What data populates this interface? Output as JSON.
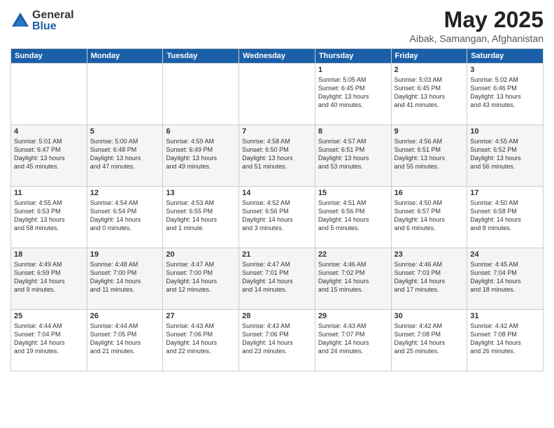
{
  "logo": {
    "general": "General",
    "blue": "Blue"
  },
  "title": "May 2025",
  "location": "Aibak, Samangan, Afghanistan",
  "weekdays": [
    "Sunday",
    "Monday",
    "Tuesday",
    "Wednesday",
    "Thursday",
    "Friday",
    "Saturday"
  ],
  "weeks": [
    [
      {
        "day": "",
        "info": ""
      },
      {
        "day": "",
        "info": ""
      },
      {
        "day": "",
        "info": ""
      },
      {
        "day": "",
        "info": ""
      },
      {
        "day": "1",
        "info": "Sunrise: 5:05 AM\nSunset: 6:45 PM\nDaylight: 13 hours\nand 40 minutes."
      },
      {
        "day": "2",
        "info": "Sunrise: 5:03 AM\nSunset: 6:45 PM\nDaylight: 13 hours\nand 41 minutes."
      },
      {
        "day": "3",
        "info": "Sunrise: 5:02 AM\nSunset: 6:46 PM\nDaylight: 13 hours\nand 43 minutes."
      }
    ],
    [
      {
        "day": "4",
        "info": "Sunrise: 5:01 AM\nSunset: 6:47 PM\nDaylight: 13 hours\nand 45 minutes."
      },
      {
        "day": "5",
        "info": "Sunrise: 5:00 AM\nSunset: 6:48 PM\nDaylight: 13 hours\nand 47 minutes."
      },
      {
        "day": "6",
        "info": "Sunrise: 4:59 AM\nSunset: 6:49 PM\nDaylight: 13 hours\nand 49 minutes."
      },
      {
        "day": "7",
        "info": "Sunrise: 4:58 AM\nSunset: 6:50 PM\nDaylight: 13 hours\nand 51 minutes."
      },
      {
        "day": "8",
        "info": "Sunrise: 4:57 AM\nSunset: 6:51 PM\nDaylight: 13 hours\nand 53 minutes."
      },
      {
        "day": "9",
        "info": "Sunrise: 4:56 AM\nSunset: 6:51 PM\nDaylight: 13 hours\nand 55 minutes."
      },
      {
        "day": "10",
        "info": "Sunrise: 4:55 AM\nSunset: 6:52 PM\nDaylight: 13 hours\nand 56 minutes."
      }
    ],
    [
      {
        "day": "11",
        "info": "Sunrise: 4:55 AM\nSunset: 6:53 PM\nDaylight: 13 hours\nand 58 minutes."
      },
      {
        "day": "12",
        "info": "Sunrise: 4:54 AM\nSunset: 6:54 PM\nDaylight: 14 hours\nand 0 minutes."
      },
      {
        "day": "13",
        "info": "Sunrise: 4:53 AM\nSunset: 6:55 PM\nDaylight: 14 hours\nand 1 minute."
      },
      {
        "day": "14",
        "info": "Sunrise: 4:52 AM\nSunset: 6:56 PM\nDaylight: 14 hours\nand 3 minutes."
      },
      {
        "day": "15",
        "info": "Sunrise: 4:51 AM\nSunset: 6:56 PM\nDaylight: 14 hours\nand 5 minutes."
      },
      {
        "day": "16",
        "info": "Sunrise: 4:50 AM\nSunset: 6:57 PM\nDaylight: 14 hours\nand 6 minutes."
      },
      {
        "day": "17",
        "info": "Sunrise: 4:50 AM\nSunset: 6:58 PM\nDaylight: 14 hours\nand 8 minutes."
      }
    ],
    [
      {
        "day": "18",
        "info": "Sunrise: 4:49 AM\nSunset: 6:59 PM\nDaylight: 14 hours\nand 9 minutes."
      },
      {
        "day": "19",
        "info": "Sunrise: 4:48 AM\nSunset: 7:00 PM\nDaylight: 14 hours\nand 11 minutes."
      },
      {
        "day": "20",
        "info": "Sunrise: 4:47 AM\nSunset: 7:00 PM\nDaylight: 14 hours\nand 12 minutes."
      },
      {
        "day": "21",
        "info": "Sunrise: 4:47 AM\nSunset: 7:01 PM\nDaylight: 14 hours\nand 14 minutes."
      },
      {
        "day": "22",
        "info": "Sunrise: 4:46 AM\nSunset: 7:02 PM\nDaylight: 14 hours\nand 15 minutes."
      },
      {
        "day": "23",
        "info": "Sunrise: 4:46 AM\nSunset: 7:03 PM\nDaylight: 14 hours\nand 17 minutes."
      },
      {
        "day": "24",
        "info": "Sunrise: 4:45 AM\nSunset: 7:04 PM\nDaylight: 14 hours\nand 18 minutes."
      }
    ],
    [
      {
        "day": "25",
        "info": "Sunrise: 4:44 AM\nSunset: 7:04 PM\nDaylight: 14 hours\nand 19 minutes."
      },
      {
        "day": "26",
        "info": "Sunrise: 4:44 AM\nSunset: 7:05 PM\nDaylight: 14 hours\nand 21 minutes."
      },
      {
        "day": "27",
        "info": "Sunrise: 4:43 AM\nSunset: 7:06 PM\nDaylight: 14 hours\nand 22 minutes."
      },
      {
        "day": "28",
        "info": "Sunrise: 4:43 AM\nSunset: 7:06 PM\nDaylight: 14 hours\nand 23 minutes."
      },
      {
        "day": "29",
        "info": "Sunrise: 4:43 AM\nSunset: 7:07 PM\nDaylight: 14 hours\nand 24 minutes."
      },
      {
        "day": "30",
        "info": "Sunrise: 4:42 AM\nSunset: 7:08 PM\nDaylight: 14 hours\nand 25 minutes."
      },
      {
        "day": "31",
        "info": "Sunrise: 4:42 AM\nSunset: 7:08 PM\nDaylight: 14 hours\nand 26 minutes."
      }
    ]
  ]
}
